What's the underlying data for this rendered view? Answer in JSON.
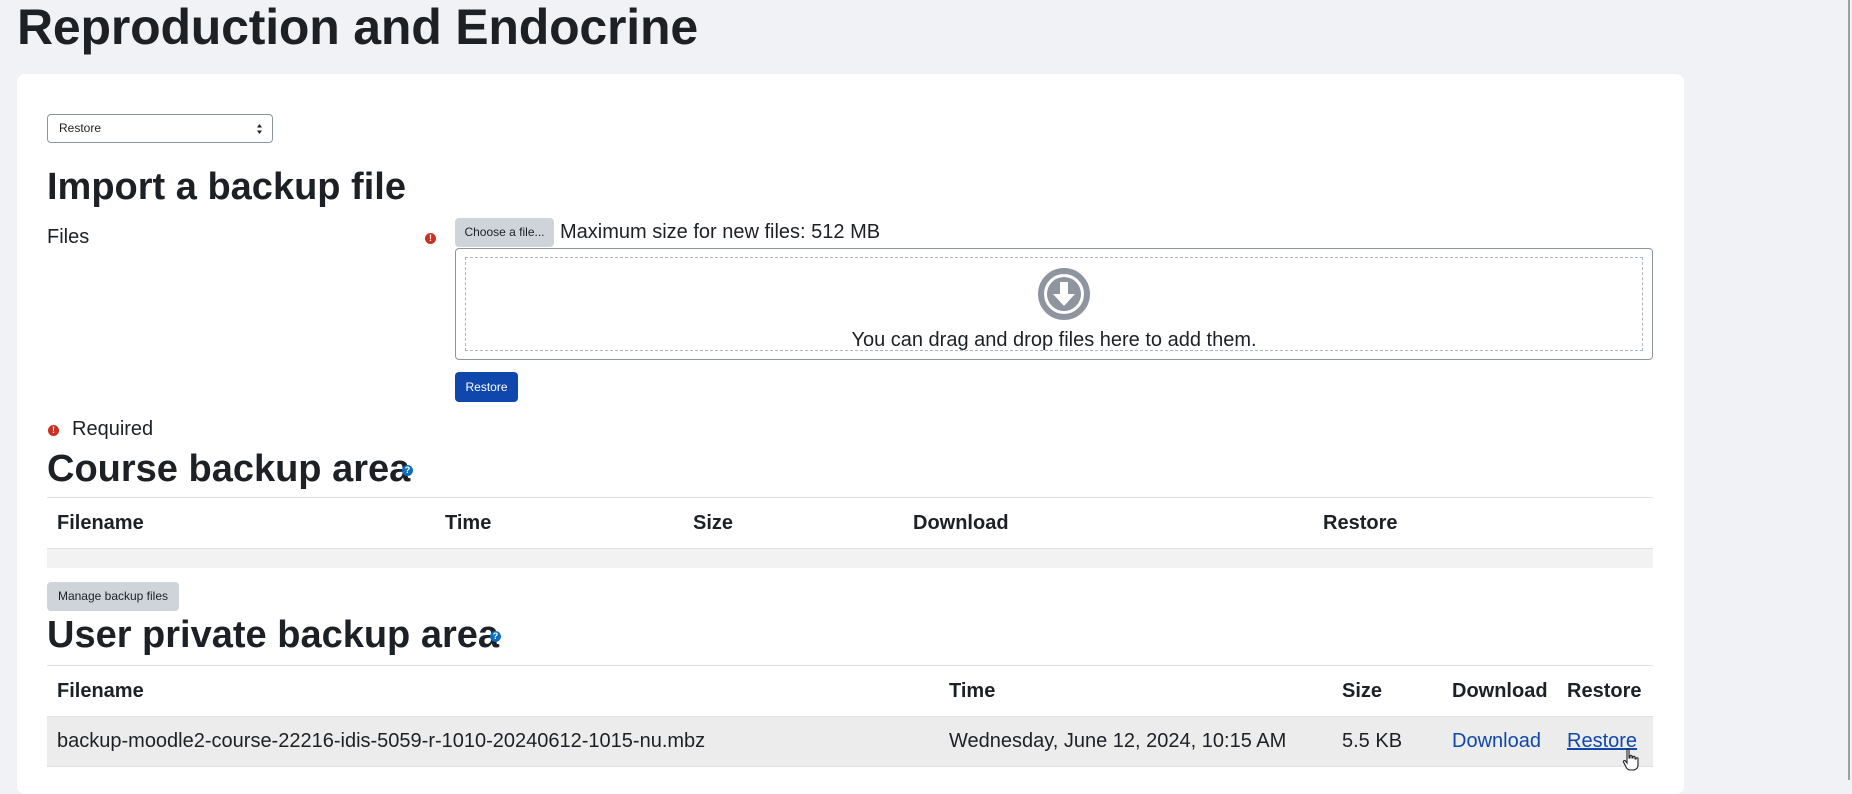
{
  "page": {
    "title": "Reproduction and Endocrine"
  },
  "select": {
    "value": "Restore"
  },
  "import": {
    "heading": "Import a backup file",
    "files_label": "Files",
    "choose_button": "Choose a file...",
    "max_size": "Maximum size for new files: 512 MB",
    "drop_text": "You can drag and drop files here to add them.",
    "restore_button": "Restore",
    "required_label": "Required",
    "required_icon": "!",
    "help_icon": "?"
  },
  "course_backup": {
    "heading": "Course backup area",
    "columns": [
      "Filename",
      "Time",
      "Size",
      "Download",
      "Restore"
    ],
    "rows": [],
    "manage_button": "Manage backup files"
  },
  "user_backup": {
    "heading": "User private backup area",
    "columns": [
      "Filename",
      "Time",
      "Size",
      "Download",
      "Restore"
    ],
    "rows": [
      {
        "filename": "backup-moodle2-course-22216-idis-5059-r-1010-20240612-1015-nu.mbz",
        "time": "Wednesday, June 12, 2024, 10:15 AM",
        "size": "5.5 KB",
        "download": "Download",
        "restore": "Restore"
      }
    ]
  },
  "colors": {
    "primary": "#0f47ad",
    "required": "#ca3120",
    "help": "#0f6cbf",
    "page_bg": "#f1f2f6"
  }
}
